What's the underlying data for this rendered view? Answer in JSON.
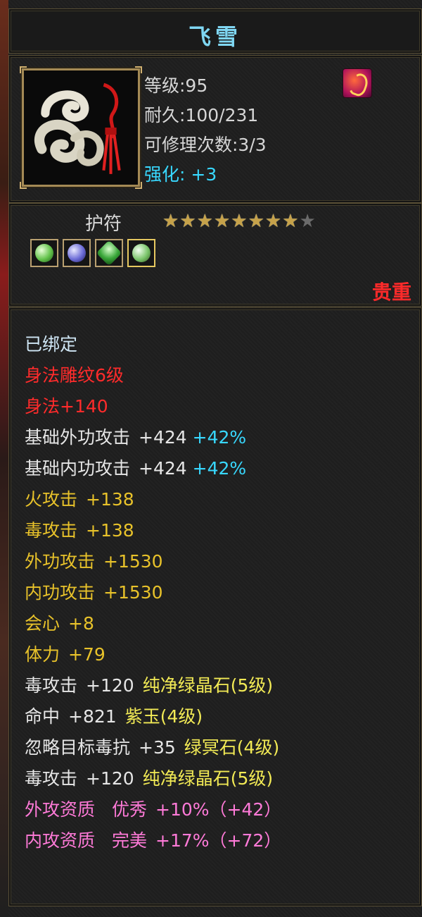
{
  "item": {
    "name": "飞雪",
    "level_text": "等级:95",
    "durability_text": "耐久:100/231",
    "repair_text": "可修理次数:3/3",
    "enhance_label": "强化:",
    "enhance_value": "+3",
    "type": "护符",
    "stars_total": 9,
    "stars_lit": 8,
    "rarity": "贵重"
  },
  "colors": {
    "title": "#7fd6f2",
    "cyan": "#38d8ff",
    "red": "#ff2b2b",
    "gold": "#e8c22a",
    "yellow": "#f2ea55",
    "pink": "#ff7ad8"
  },
  "gems": [
    {
      "icon": "green-crystal-gem-icon"
    },
    {
      "icon": "purple-crystal-gem-icon"
    },
    {
      "icon": "green-leaf-gem-icon"
    },
    {
      "icon": "green-crystal-gem-icon"
    }
  ],
  "stats": {
    "bound": "已绑定",
    "engrave_level": "身法雕纹6级",
    "agility": "身法+140",
    "base_outer_label": "基础外功攻击",
    "base_outer_value": "+424",
    "base_outer_pct": "+42%",
    "base_inner_label": "基础内功攻击",
    "base_inner_value": "+424",
    "base_inner_pct": "+42%",
    "fire_label": "火攻击",
    "fire_value": "+138",
    "poison_label": "毒攻击",
    "poison_value": "+138",
    "outer_label": "外功攻击",
    "outer_value": "+1530",
    "inner_label": "内功攻击",
    "inner_value": "+1530",
    "crit_label": "会心",
    "crit_value": "+8",
    "stamina_label": "体力",
    "stamina_value": "+79",
    "socket1_label": "毒攻击",
    "socket1_value": "+120",
    "socket1_gem": "纯净绿晶石(5级)",
    "socket2_label": "命中",
    "socket2_value": "+821",
    "socket2_gem": "紫玉(4级)",
    "socket3_label": "忽略目标毒抗",
    "socket3_value": "+35",
    "socket3_gem": "绿冥石(4级)",
    "socket4_label": "毒攻击",
    "socket4_value": "+120",
    "socket4_gem": "纯净绿晶石(5级)",
    "q1_label": "外攻资质",
    "q1_grade": "优秀",
    "q1_value": "+10%（+42）",
    "q2_label": "内攻资质",
    "q2_grade": "完美",
    "q2_value": "+17%（+72）"
  }
}
